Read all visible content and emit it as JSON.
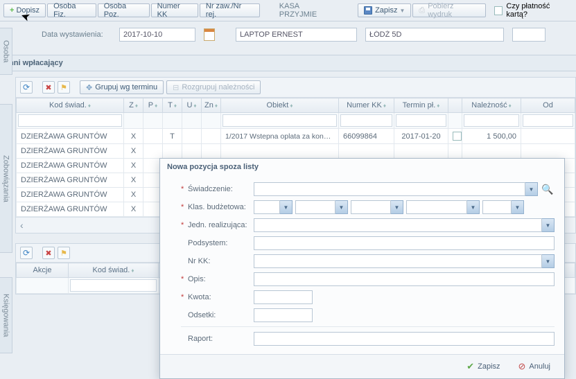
{
  "toolbar": {
    "dopisz": "Dopisz",
    "osoba_fiz": "Osoba Fiz.",
    "osoba_poz": "Osoba Poz.",
    "numer_kk": "Numer KK",
    "nr_zaw": "Nr zaw./Nr rej.",
    "kasa": "KASA PRZYJMIE",
    "zapisz": "Zapisz",
    "pobierz": "Pobierz wydruk",
    "czy_karta": "Czy płatność kartą?"
  },
  "form": {
    "data_wyst_lbl": "Data wystawienia:",
    "data_wyst_val": "2017-10-10",
    "laptop": "LAPTOP ERNEST",
    "lodz": "ŁÓDŹ 5D",
    "last": ""
  },
  "side": {
    "osoba": "Osoba",
    "zobow": "Zobowiązania",
    "ksieg": "Księgowania"
  },
  "section": {
    "inni": "Inni wpłacający"
  },
  "grid_toolbar": {
    "grupuj": "Grupuj wg terminu",
    "rozgrupuj": "Rozgrupuj należności"
  },
  "cols": {
    "kod": "Kod świad.",
    "z": "Z",
    "p": "P",
    "t": "T",
    "u": "U",
    "zn": "Zn",
    "obiekt": "Obiekt",
    "numer_kk": "Numer KK",
    "termin": "Termin pł.",
    "naleznosc": "Należność",
    "od": "Od"
  },
  "rows": [
    {
      "kod": "DZIERŻAWA GRUNTÓW",
      "z": "X",
      "t": "T",
      "obiekt": "1/2017 Wstepna oplata za konser…",
      "kk": "66099864",
      "termin": "2017-01-20",
      "nalez": "1 500,00"
    },
    {
      "kod": "DZIERŻAWA GRUNTÓW",
      "z": "X"
    },
    {
      "kod": "DZIERŻAWA GRUNTÓW",
      "z": "X"
    },
    {
      "kod": "DZIERŻAWA GRUNTÓW",
      "z": "X"
    },
    {
      "kod": "DZIERŻAWA GRUNTÓW",
      "z": "X"
    },
    {
      "kod": "DZIERŻAWA GRUNTÓW",
      "z": "X"
    }
  ],
  "lower": {
    "akcje": "Akcje",
    "kod": "Kod świad."
  },
  "modal": {
    "title": "Nowa pozycja spoza listy",
    "swiadczenie": "Świadczenie:",
    "klas": "Klas. budżetowa:",
    "jedn": "Jedn. realizująca:",
    "podsystem": "Podsystem:",
    "nrkk": "Nr KK:",
    "opis": "Opis:",
    "kwota": "Kwota:",
    "odsetki": "Odsetki:",
    "raport": "Raport:",
    "zapisz": "Zapisz",
    "anuluj": "Anuluj"
  }
}
